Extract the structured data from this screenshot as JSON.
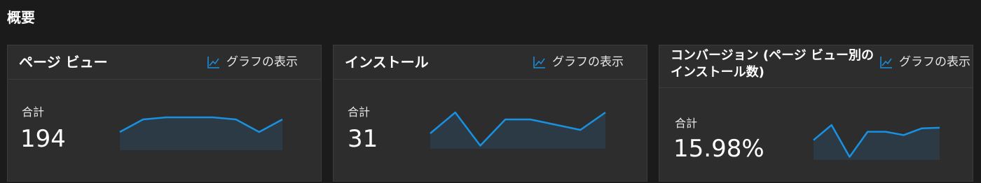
{
  "section": {
    "title": "概要"
  },
  "cards": [
    {
      "title": "ページ ビュー",
      "chart_link_label": "グラフの表示",
      "total_label": "合計",
      "value": "194",
      "sparkline": [
        0.6,
        0.3,
        0.25,
        0.25,
        0.25,
        0.3,
        0.6,
        0.3
      ]
    },
    {
      "title": "インストール",
      "chart_link_label": "グラフの表示",
      "total_label": "合計",
      "value": "31",
      "sparkline": [
        0.6,
        0.0,
        0.95,
        0.2,
        0.2,
        0.35,
        0.5,
        0.0
      ]
    },
    {
      "title": "コンバージョン (ページ ビュー別のインストール数)",
      "chart_link_label": "グラフの表示",
      "total_label": "合計",
      "value": "15.98%",
      "sparkline": [
        0.45,
        0.0,
        0.95,
        0.2,
        0.2,
        0.3,
        0.1,
        0.08
      ]
    }
  ],
  "colors": {
    "accent": "#1a91e0",
    "area_fill": "#2b3a45",
    "background": "#1b1b1b",
    "card": "#2d2d2d"
  }
}
